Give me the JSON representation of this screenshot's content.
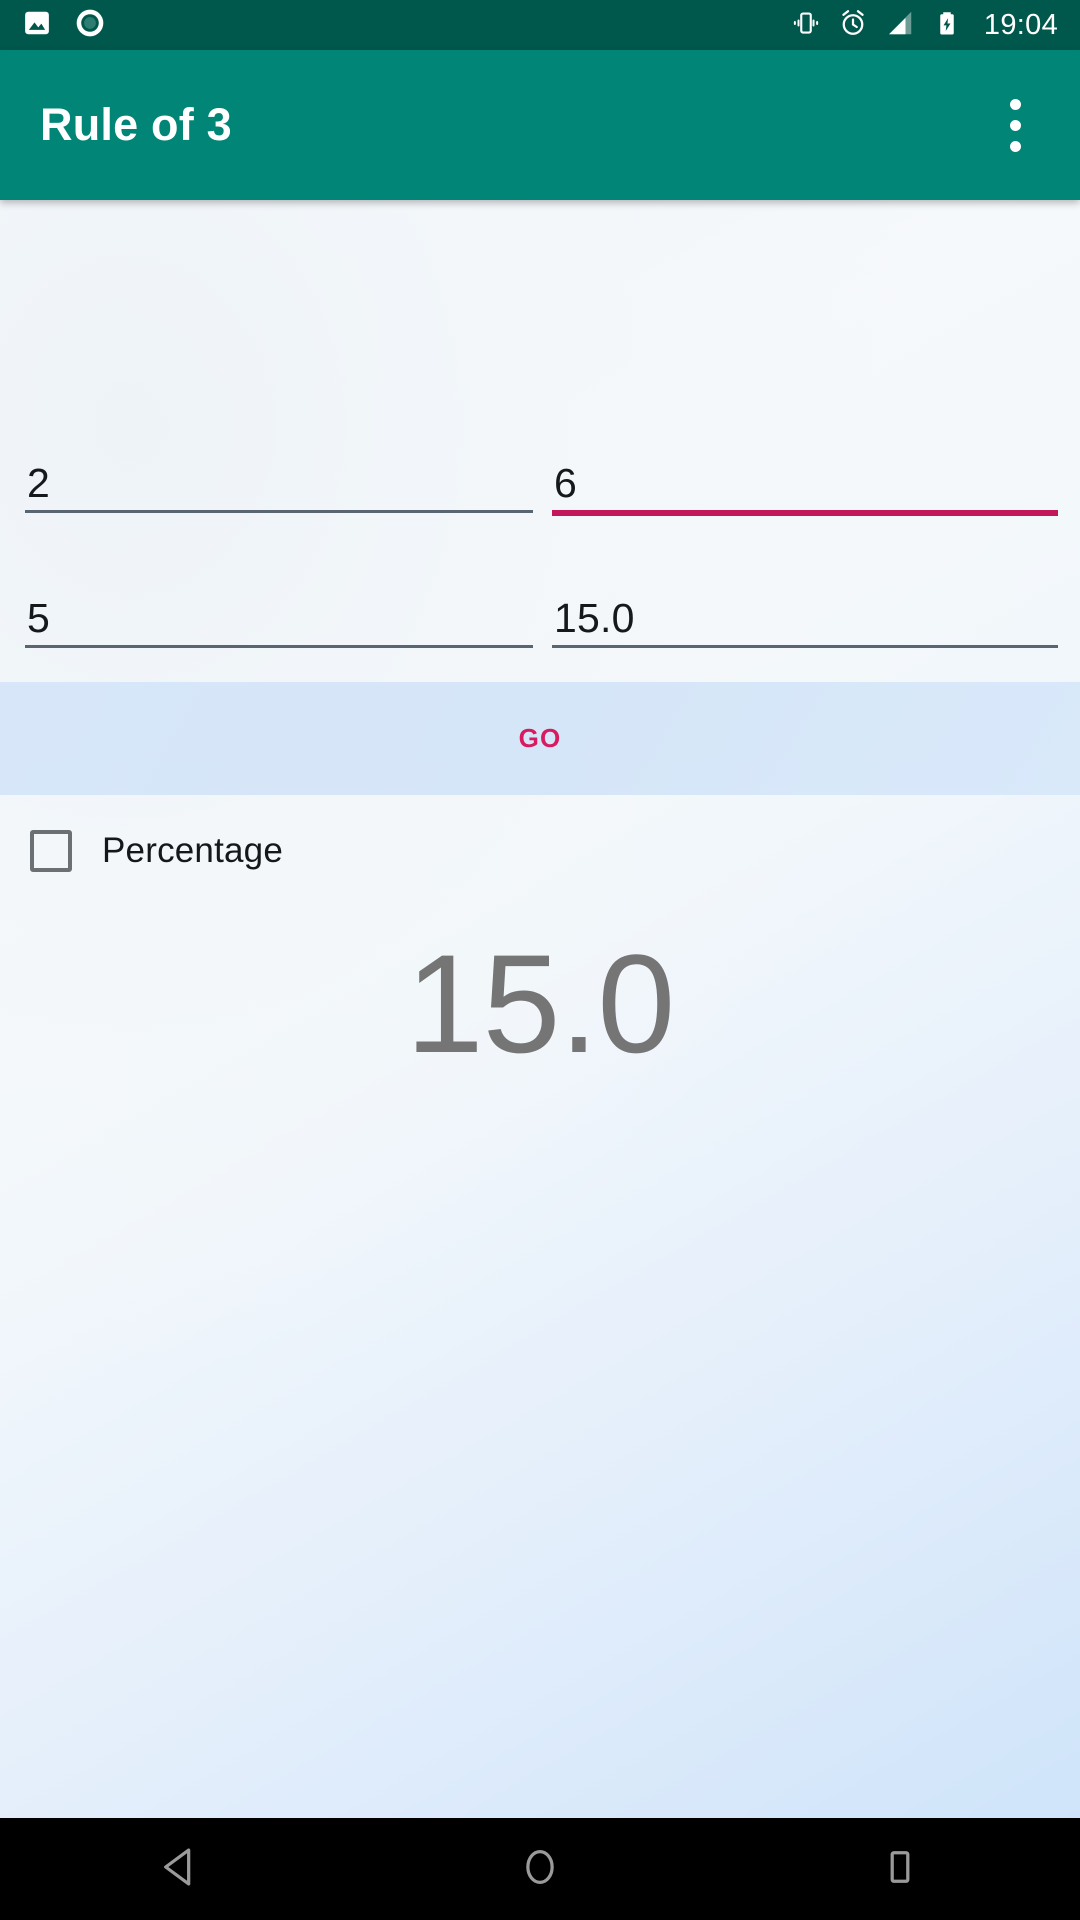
{
  "status_bar": {
    "background": "#00574b",
    "left_icons": [
      {
        "name": "image-icon",
        "label": "Screenshot"
      },
      {
        "name": "screen-record-icon",
        "label": "Screen recorder"
      }
    ],
    "right_icons": [
      {
        "name": "vibrate-icon",
        "label": "Vibrate mode"
      },
      {
        "name": "alarm-icon",
        "label": "Alarm set"
      },
      {
        "name": "signal-icon",
        "label": "Signal strength"
      },
      {
        "name": "battery-charging-icon",
        "label": "Battery charging"
      }
    ],
    "clock": "19:04"
  },
  "app_bar": {
    "title": "Rule of 3",
    "background": "#008577",
    "overflow_label": "More options"
  },
  "form": {
    "rows": [
      {
        "left": {
          "value": "2",
          "placeholder": "",
          "focused": false
        },
        "right": {
          "value": "6",
          "placeholder": "",
          "focused": true
        }
      },
      {
        "left": {
          "value": "5",
          "placeholder": "",
          "focused": false
        },
        "right": {
          "value": "15.0",
          "placeholder": "",
          "focused": false
        }
      }
    ],
    "focus_color": "#c2185b",
    "underline_color": "#5a6572"
  },
  "go": {
    "label": "GO",
    "color": "#d81b60",
    "band_color": "#d7e7f9"
  },
  "percentage": {
    "label": "Percentage",
    "checked": false
  },
  "result": {
    "value": "15.0",
    "color": "#757575"
  },
  "nav_bar": {
    "background": "#000000",
    "buttons": [
      {
        "name": "back-icon",
        "label": "Back"
      },
      {
        "name": "home-icon",
        "label": "Home"
      },
      {
        "name": "recents-icon",
        "label": "Recent apps"
      }
    ]
  }
}
